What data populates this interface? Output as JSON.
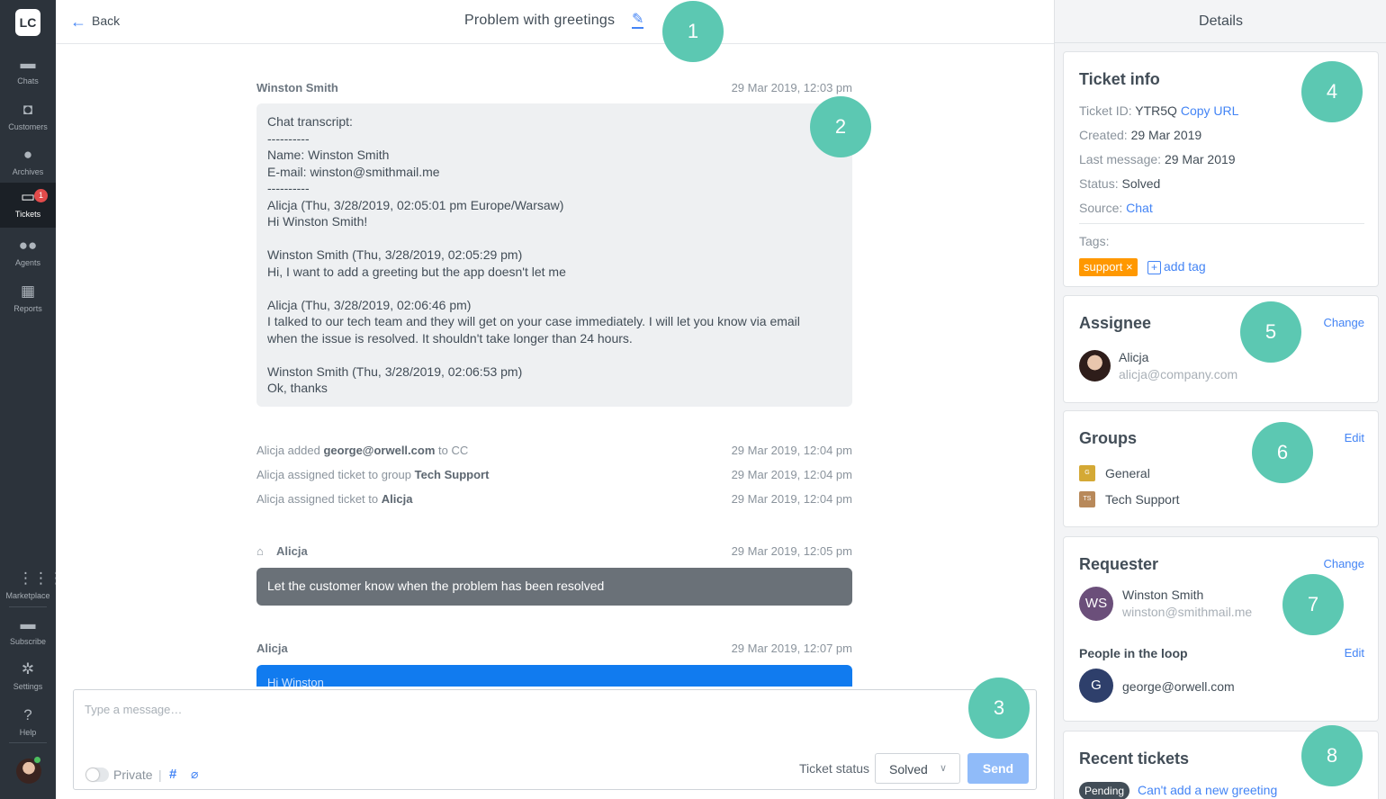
{
  "nav": {
    "logo": "LC",
    "items": [
      {
        "label": "Chats"
      },
      {
        "label": "Customers"
      },
      {
        "label": "Archives"
      },
      {
        "label": "Tickets",
        "badge": "1"
      },
      {
        "label": "Agents"
      },
      {
        "label": "Reports"
      },
      {
        "label": "Marketplace"
      },
      {
        "label": "Subscribe"
      },
      {
        "label": "Settings"
      },
      {
        "label": "Help"
      }
    ]
  },
  "header": {
    "back_label": "Back",
    "title": "Problem with greetings"
  },
  "markers": [
    "1",
    "2",
    "3",
    "4",
    "5",
    "6",
    "7",
    "8"
  ],
  "messages": {
    "first_author": "Winston Smith",
    "first_time": "29 Mar 2019, 12:03 pm",
    "transcript": "Chat transcript:\n----------\nName: Winston Smith\nE-mail: winston@smithmail.me\n----------\nAlicja (Thu, 3/28/2019, 02:05:01 pm Europe/Warsaw)\nHi Winston Smith!\n\nWinston Smith (Thu, 3/28/2019, 02:05:29 pm)\nHi, I want to add a greeting but the app doesn't let me\n\nAlicja (Thu, 3/28/2019, 02:06:46 pm)\nI talked to our tech team and they will get on your case immediately. I will let you know via email\nwhen the issue is resolved. It shouldn't take longer than 24 hours.\n\nWinston Smith (Thu, 3/28/2019, 02:06:53 pm)\nOk, thanks",
    "events": [
      {
        "pre": "Alicja added ",
        "bold": "george@orwell.com",
        "post": " to CC",
        "time": "29 Mar 2019, 12:04 pm"
      },
      {
        "pre": "Alicja assigned ticket to group ",
        "bold": "Tech Support",
        "post": "",
        "time": "29 Mar 2019, 12:04 pm"
      },
      {
        "pre": "Alicja assigned ticket to ",
        "bold": "Alicja",
        "post": "",
        "time": "29 Mar 2019, 12:04 pm"
      }
    ],
    "note_author": "Alicja",
    "note_time": "29 Mar 2019, 12:05 pm",
    "note_text": "Let the customer know when the problem has been resolved",
    "reply_author": "Alicja",
    "reply_time": "29 Mar 2019, 12:07 pm",
    "reply_text": "Hi Winston"
  },
  "composer": {
    "placeholder": "Type a message…",
    "private_label": "Private",
    "separator": "|",
    "status_label": "Ticket status",
    "status_value": "Solved",
    "send_label": "Send"
  },
  "details": {
    "title": "Details",
    "ticket_info": {
      "title": "Ticket info",
      "id_label": "Ticket ID:",
      "id_value": "YTR5Q",
      "copy_url": "Copy URL",
      "created_label": "Created:",
      "created_value": "29 Mar 2019",
      "last_label": "Last message:",
      "last_value": "29 Mar 2019",
      "status_label": "Status:",
      "status_value": "Solved",
      "source_label": "Source:",
      "source_value": "Chat",
      "tags_label": "Tags:",
      "tag": "support ×",
      "add_tag": "add tag"
    },
    "assignee": {
      "title": "Assignee",
      "action": "Change",
      "name": "Alicja",
      "email": "alicja@company.com"
    },
    "groups": {
      "title": "Groups",
      "action": "Edit",
      "items": [
        {
          "badge": "G",
          "name": "General",
          "color": "#d4a935"
        },
        {
          "badge": "TS",
          "name": "Tech Support",
          "color": "#b8895a"
        }
      ]
    },
    "requester": {
      "title": "Requester",
      "action": "Change",
      "initials": "WS",
      "name": "Winston Smith",
      "email": "winston@smithmail.me",
      "loop_title": "People in the loop",
      "loop_action": "Edit",
      "loop_initial": "G",
      "loop_email": "george@orwell.com"
    },
    "recent": {
      "title": "Recent tickets",
      "status": "Pending",
      "link": "Can't add a new greeting"
    }
  },
  "colors": {
    "accent": "#4384f5",
    "marker": "#5cc8b2",
    "nav_bg": "#2c333b",
    "tag": "#ff9800",
    "badge": "#e24b4b"
  }
}
